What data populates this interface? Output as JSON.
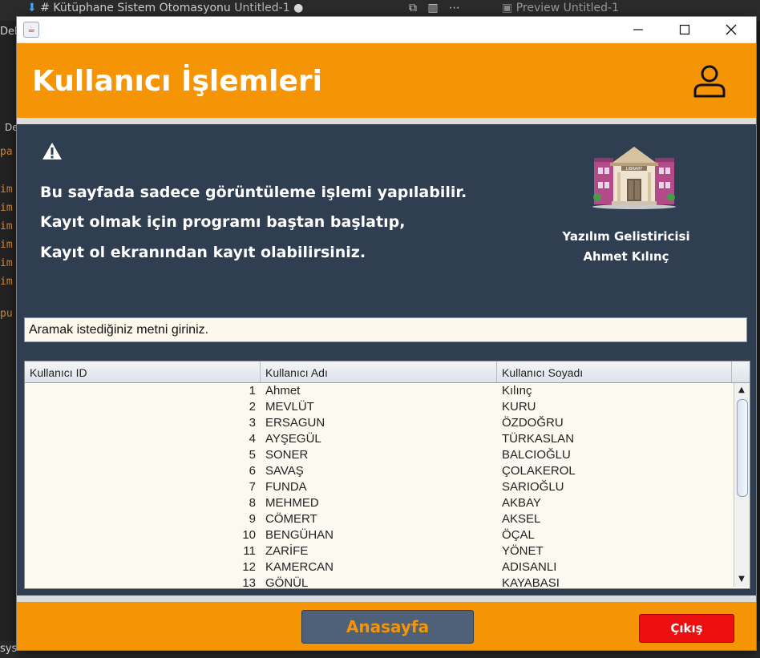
{
  "background_ide": {
    "tab_1": "# Kütüphane Sistem Otomasyonu",
    "tab_1_sub": "Untitled-1",
    "tab_2": "Preview Untitled-1",
    "left_fragment_top": "Deb",
    "left_fragment_mid": "De",
    "left_fragment_bottom": "sys",
    "gutter": [
      "pa",
      "im",
      "im",
      "im",
      "im",
      "im",
      "im",
      "pu"
    ]
  },
  "window": {
    "header_title": "Kullanıcı İşlemleri"
  },
  "info": {
    "line1": "Bu sayfada sadece görüntüleme işlemi yapılabilir.",
    "line2": "Kayıt olmak için programı baştan başlatıp,",
    "line3": "Kayıt ol ekranından kayıt olabilirsiniz.",
    "library_sign": "LIBRARY",
    "developer_label": "Yazılım Gelistiricisi",
    "developer_name": "Ahmet Kılınç"
  },
  "search": {
    "value": "Aramak istediğiniz metni giriniz."
  },
  "table": {
    "columns": [
      "Kullanıcı ID",
      "Kullanıcı Adı",
      "Kullanıcı Soyadı"
    ],
    "rows": [
      [
        "1",
        "Ahmet",
        "Kılınç"
      ],
      [
        "2",
        "MEVLÜT",
        "KURU"
      ],
      [
        "3",
        "ERSAGUN",
        "ÖZDOĞRU"
      ],
      [
        "4",
        "AYŞEGÜL",
        "TÜRKASLAN"
      ],
      [
        "5",
        "SONER",
        "BALCIOĞLU"
      ],
      [
        "6",
        "SAVAŞ",
        "ÇOLAKEROL"
      ],
      [
        "7",
        "FUNDA",
        "SARIOĞLU"
      ],
      [
        "8",
        "MEHMED",
        "AKBAY"
      ],
      [
        "9",
        "CÖMERT",
        "AKSEL"
      ],
      [
        "10",
        "BENGÜHAN",
        "ÖÇAL"
      ],
      [
        "11",
        "ZARİFE",
        "YÖNET"
      ],
      [
        "12",
        "KAMERCAN",
        "ADISANLI"
      ],
      [
        "13",
        "GÖNÜL",
        "KAYABAŞI"
      ]
    ]
  },
  "footer": {
    "home_label": "Anasayfa",
    "exit_label": "Çıkış"
  },
  "colors": {
    "accent_orange": "#f59505",
    "panel_navy": "#2f3e50",
    "exit_red": "#ec1010"
  },
  "icons": [
    "java-icon",
    "minimize-icon",
    "maximize-icon",
    "close-icon",
    "user-icon",
    "warning-icon",
    "library-building-icon",
    "scroll-up-icon",
    "scroll-down-icon"
  ]
}
